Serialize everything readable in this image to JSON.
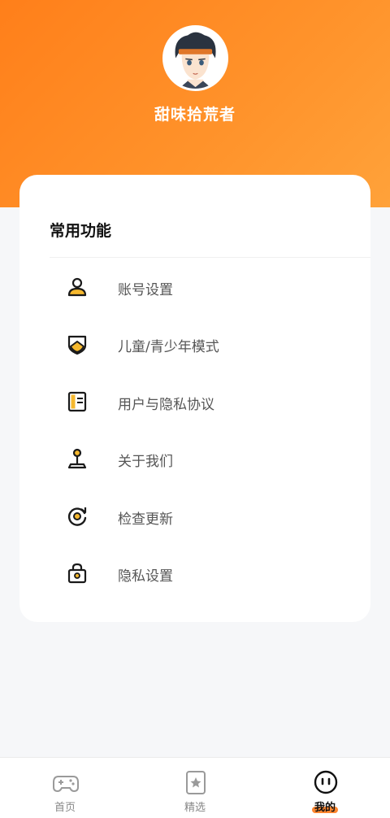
{
  "profile": {
    "username": "甜味拾荒者",
    "avatar_icon": "user-avatar"
  },
  "menu": {
    "title": "常用功能",
    "items": [
      {
        "label": "账号设置",
        "icon": "user-icon"
      },
      {
        "label": "儿童/青少年模式",
        "icon": "shield-icon"
      },
      {
        "label": "用户与隐私协议",
        "icon": "document-icon"
      },
      {
        "label": "关于我们",
        "icon": "joystick-icon"
      },
      {
        "label": "检查更新",
        "icon": "refresh-icon"
      },
      {
        "label": "隐私设置",
        "icon": "lock-bag-icon"
      }
    ]
  },
  "tabbar": {
    "tabs": [
      {
        "label": "首页",
        "icon": "gamepad-icon",
        "active": false
      },
      {
        "label": "精选",
        "icon": "star-bookmark-icon",
        "active": false
      },
      {
        "label": "我的",
        "icon": "smiley-icon",
        "active": true
      }
    ]
  },
  "colors": {
    "accent": "#ff8a1f",
    "icon_fill": "#f5b82e"
  }
}
